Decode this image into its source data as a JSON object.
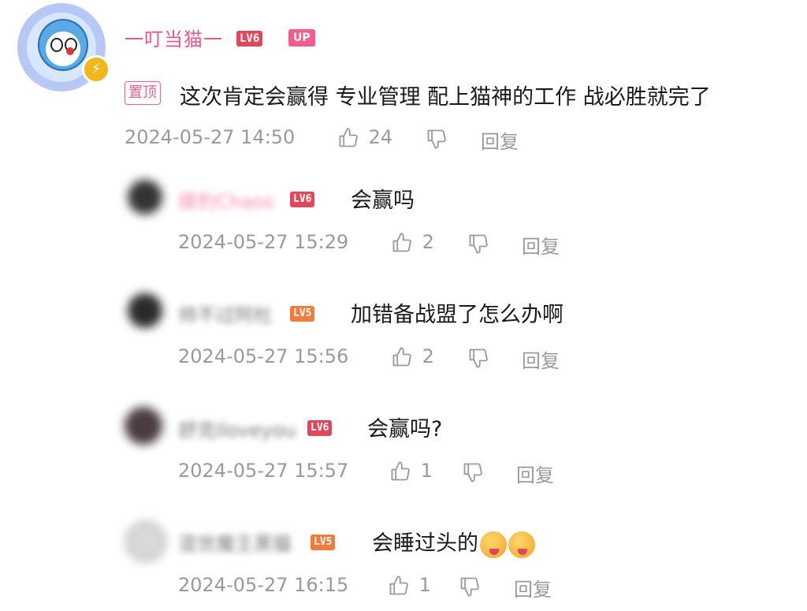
{
  "main_comment": {
    "username": "一叮当猫一",
    "level": "LV6",
    "up_badge": "UP",
    "pin_label": "置顶",
    "text": "这次肯定会赢得 专业管理 配上猫神的工作 战必胜就完了",
    "timestamp": "2024-05-27 14:50",
    "likes": "24",
    "reply_label": "回复"
  },
  "replies": [
    {
      "username": "摸豹Chaos",
      "level": "LV6",
      "text": "会赢吗",
      "timestamp": "2024-05-27 15:29",
      "likes": "2",
      "reply_label": "回复"
    },
    {
      "username": "帅不过阿杜",
      "level": "LV5",
      "text": "加错备战盟了怎么办啊",
      "timestamp": "2024-05-27 15:56",
      "likes": "2",
      "reply_label": "回复"
    },
    {
      "username": "舒克Iloveyou",
      "level": "LV6",
      "text": "会赢吗?",
      "timestamp": "2024-05-27 15:57",
      "likes": "1",
      "reply_label": "回复"
    },
    {
      "username": "混世魔王黑猫",
      "level": "LV5",
      "text": "会睡过头的",
      "timestamp": "2024-05-27 16:15",
      "likes": "1",
      "reply_label": "回复"
    }
  ],
  "colors": {
    "username_pink": "#e8588c",
    "lv6": "#e0475a",
    "lv5": "#f07c3c",
    "up_badge": "#f25d8e",
    "meta_gray": "#9a9a9a"
  },
  "icons": [
    "thumbs-up-icon",
    "thumbs-down-icon",
    "bolt-icon",
    "emoji-icon"
  ]
}
